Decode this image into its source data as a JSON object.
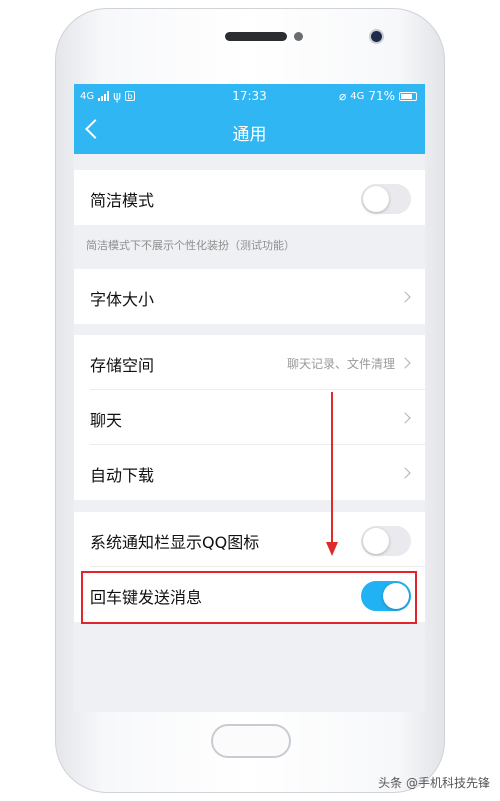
{
  "status_bar": {
    "network_left": "4G",
    "time": "17:33",
    "network_right": "4G",
    "battery_percent": "71%"
  },
  "nav": {
    "back_icon": "chevron-left-icon",
    "title": "通用"
  },
  "settings": {
    "simple_mode": {
      "label": "简洁模式",
      "enabled": false
    },
    "simple_mode_hint": "简洁模式下不展示个性化装扮（测试功能）",
    "font_size": {
      "label": "字体大小"
    },
    "storage": {
      "label": "存储空间",
      "subtitle": "聊天记录、文件清理"
    },
    "chat": {
      "label": "聊天"
    },
    "auto_download": {
      "label": "自动下载"
    },
    "notification_icon": {
      "label": "系统通知栏显示QQ图标",
      "enabled": false
    },
    "enter_to_send": {
      "label": "回车键发送消息",
      "enabled": true
    }
  },
  "colors": {
    "header": "#2fb6f3",
    "toggle_on": "#21b2f3",
    "annotation": "#e0262d"
  },
  "watermark": "头条 @手机科技先锋"
}
